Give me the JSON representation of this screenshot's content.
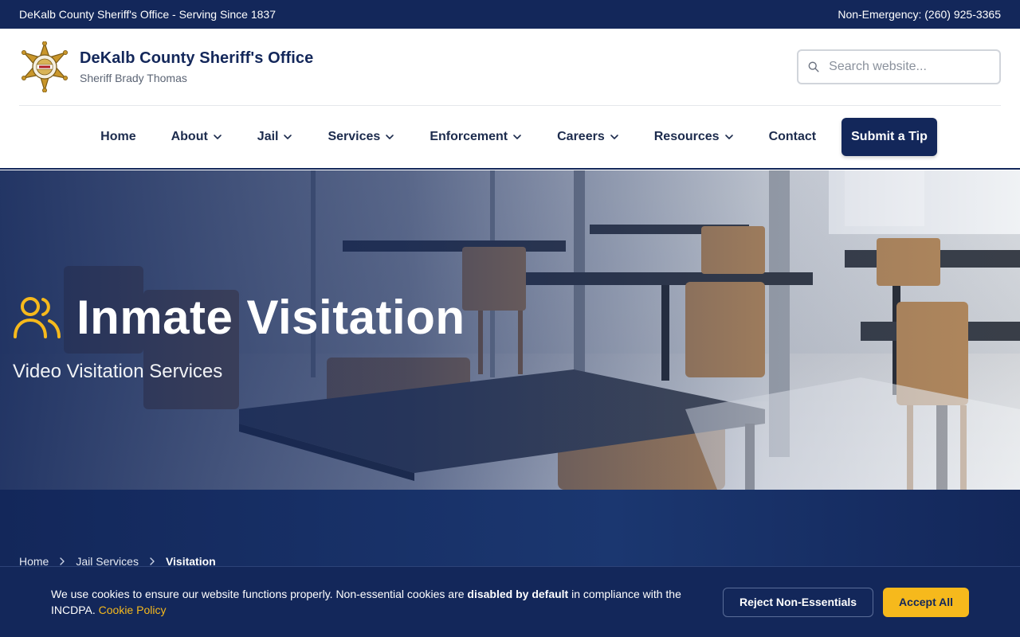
{
  "topbar": {
    "left_text": "DeKalb County Sheriff's Office - Serving Since 1837",
    "right_text": "Non-Emergency: (260) 925-3365"
  },
  "header": {
    "title": "DeKalb County Sheriff's Office",
    "subtitle": "Sheriff Brady Thomas",
    "logo_icon": "sheriff-star-badge-icon"
  },
  "search": {
    "placeholder": "Search website...",
    "value": ""
  },
  "nav": {
    "items": [
      {
        "label": "Home",
        "dropdown": false
      },
      {
        "label": "About",
        "dropdown": true
      },
      {
        "label": "Jail",
        "dropdown": true
      },
      {
        "label": "Services",
        "dropdown": true
      },
      {
        "label": "Enforcement",
        "dropdown": true
      },
      {
        "label": "Careers",
        "dropdown": true
      },
      {
        "label": "Resources",
        "dropdown": true
      },
      {
        "label": "Contact",
        "dropdown": false
      }
    ],
    "cta_label": "Submit a Tip"
  },
  "hero": {
    "title": "Inmate Visitation",
    "subtitle": "Video Visitation Services",
    "icon": "users-icon"
  },
  "breadcrumb": {
    "items": [
      "Home",
      "Jail Services"
    ],
    "current": "Visitation"
  },
  "cookie": {
    "text_part1": "We use cookies to ensure our website functions properly. Non-essential cookies are ",
    "text_bold": "disabled by default",
    "text_part2": " in compliance with the INCDPA. ",
    "link_label": "Cookie Policy",
    "reject_label": "Reject Non-Essentials",
    "accept_label": "Accept All"
  },
  "colors": {
    "navy": "#13275a",
    "gold": "#f6b91c",
    "white": "#ffffff"
  }
}
